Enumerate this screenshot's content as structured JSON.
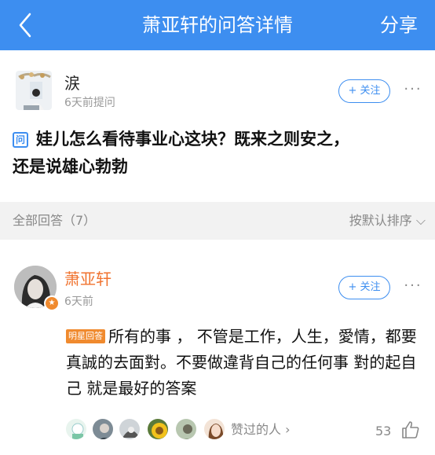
{
  "navbar": {
    "title": "萧亚轩的问答详情",
    "share_label": "分享"
  },
  "asker": {
    "name": "涙",
    "meta": "6天前提问"
  },
  "follow_label": "+ 关注",
  "more_label": "···",
  "question": {
    "icon_label": "问",
    "line1": "娃儿怎么看待事业心这块？既来之则安之，",
    "line2": "还是说雄心勃勃"
  },
  "answers_header": {
    "count_label": "全部回答（7）",
    "sort_label": "按默认排序 ⌵"
  },
  "answer": {
    "author": "萧亚轩",
    "time": "6天前",
    "star_tag": "明星回答",
    "text": "所有的事 ， 不管是工作，人生，愛情，都要真誠的去面對。不要做違背自己的任何事 對的起自己 就是最好的答案",
    "likers_label": "赞过的人 ›",
    "like_count": "53"
  },
  "colors": {
    "accent": "#3d8ef0",
    "star": "#f08a2e"
  },
  "icons": [
    "back-arrow-icon",
    "more-icon",
    "question-icon",
    "star-badge-icon",
    "thumb-up-icon",
    "chevron-right-icon"
  ]
}
